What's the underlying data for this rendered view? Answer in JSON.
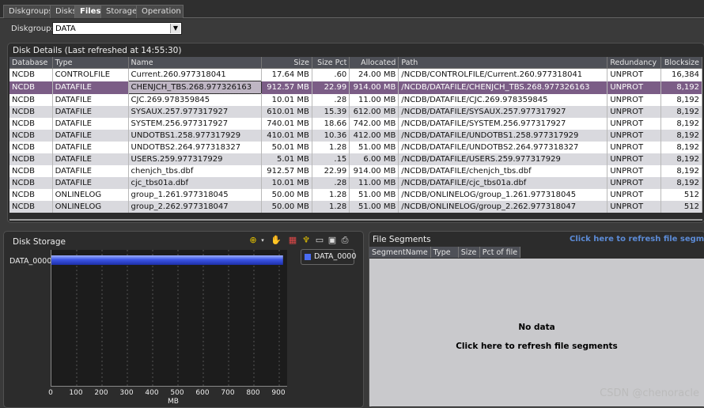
{
  "tabs": [
    {
      "label": "Diskgroups",
      "active": false
    },
    {
      "label": "Disks",
      "active": false
    },
    {
      "label": "Files",
      "active": true
    },
    {
      "label": "Storage",
      "active": false
    },
    {
      "label": "Operation",
      "active": false
    }
  ],
  "diskgroup": {
    "label": "Diskgroup:",
    "value": "DATA"
  },
  "disk_details": {
    "title": "Disk Details (Last refreshed at 14:55:30)",
    "columns": [
      "Database",
      "Type",
      "Name",
      "Size",
      "Size Pct",
      "Allocated",
      "Path",
      "Redundancy",
      "Blocksize"
    ],
    "rows": [
      [
        "NCDB",
        "CONTROLFILE",
        "Current.260.977318041",
        "17.64 MB",
        ".60",
        "24.00 MB",
        "/NCDB/CONTROLFILE/Current.260.977318041",
        "UNPROT",
        "16,384"
      ],
      [
        "NCDB",
        "DATAFILE",
        "CHENJCH_TBS.268.977326163",
        "912.57 MB",
        "22.99",
        "914.00 MB",
        "/NCDB/DATAFILE/CHENJCH_TBS.268.977326163",
        "UNPROT",
        "8,192"
      ],
      [
        "NCDB",
        "DATAFILE",
        "CJC.269.978359845",
        "10.01 MB",
        ".28",
        "11.00 MB",
        "/NCDB/DATAFILE/CJC.269.978359845",
        "UNPROT",
        "8,192"
      ],
      [
        "NCDB",
        "DATAFILE",
        "SYSAUX.257.977317927",
        "610.01 MB",
        "15.39",
        "612.00 MB",
        "/NCDB/DATAFILE/SYSAUX.257.977317927",
        "UNPROT",
        "8,192"
      ],
      [
        "NCDB",
        "DATAFILE",
        "SYSTEM.256.977317927",
        "740.01 MB",
        "18.66",
        "742.00 MB",
        "/NCDB/DATAFILE/SYSTEM.256.977317927",
        "UNPROT",
        "8,192"
      ],
      [
        "NCDB",
        "DATAFILE",
        "UNDOTBS1.258.977317929",
        "410.01 MB",
        "10.36",
        "412.00 MB",
        "/NCDB/DATAFILE/UNDOTBS1.258.977317929",
        "UNPROT",
        "8,192"
      ],
      [
        "NCDB",
        "DATAFILE",
        "UNDOTBS2.264.977318327",
        "50.01 MB",
        "1.28",
        "51.00 MB",
        "/NCDB/DATAFILE/UNDOTBS2.264.977318327",
        "UNPROT",
        "8,192"
      ],
      [
        "NCDB",
        "DATAFILE",
        "USERS.259.977317929",
        "5.01 MB",
        ".15",
        "6.00 MB",
        "/NCDB/DATAFILE/USERS.259.977317929",
        "UNPROT",
        "8,192"
      ],
      [
        "NCDB",
        "DATAFILE",
        "chenjch_tbs.dbf",
        "912.57 MB",
        "22.99",
        "914.00 MB",
        "/NCDB/DATAFILE/chenjch_tbs.dbf",
        "UNPROT",
        "8,192"
      ],
      [
        "NCDB",
        "DATAFILE",
        "cjc_tbs01a.dbf",
        "10.01 MB",
        ".28",
        "11.00 MB",
        "/NCDB/DATAFILE/cjc_tbs01a.dbf",
        "UNPROT",
        "8,192"
      ],
      [
        "NCDB",
        "ONLINELOG",
        "group_1.261.977318045",
        "50.00 MB",
        "1.28",
        "51.00 MB",
        "/NCDB/ONLINELOG/group_1.261.977318045",
        "UNPROT",
        "512"
      ],
      [
        "NCDB",
        "ONLINELOG",
        "group_2.262.977318047",
        "50.00 MB",
        "1.28",
        "51.00 MB",
        "/NCDB/ONLINELOG/group_2.262.977318047",
        "UNPROT",
        "512"
      ]
    ],
    "selected_row": 1
  },
  "disk_storage": {
    "title": "Disk Storage"
  },
  "chart_data": {
    "type": "bar",
    "orientation": "horizontal",
    "categories": [
      "DATA_0000"
    ],
    "values": [
      915
    ],
    "series": [
      {
        "name": "DATA_0000",
        "values": [
          915
        ]
      }
    ],
    "xlabel": "MB",
    "xlim": [
      0,
      900
    ],
    "xticks": [
      0,
      100,
      200,
      300,
      400,
      500,
      600,
      700,
      800,
      900
    ],
    "legend": "top-right",
    "grid": true,
    "bar_color": "#3b55e6"
  },
  "file_segments": {
    "title": "File Segments",
    "refresh_link": "Click here to refresh file segment",
    "columns": [
      "SegmentName",
      "Type",
      "Size",
      "Pct of file"
    ],
    "no_data": "No data",
    "refresh_text": "Click here to refresh file segments"
  },
  "watermark": "CSDN @chenoracle"
}
